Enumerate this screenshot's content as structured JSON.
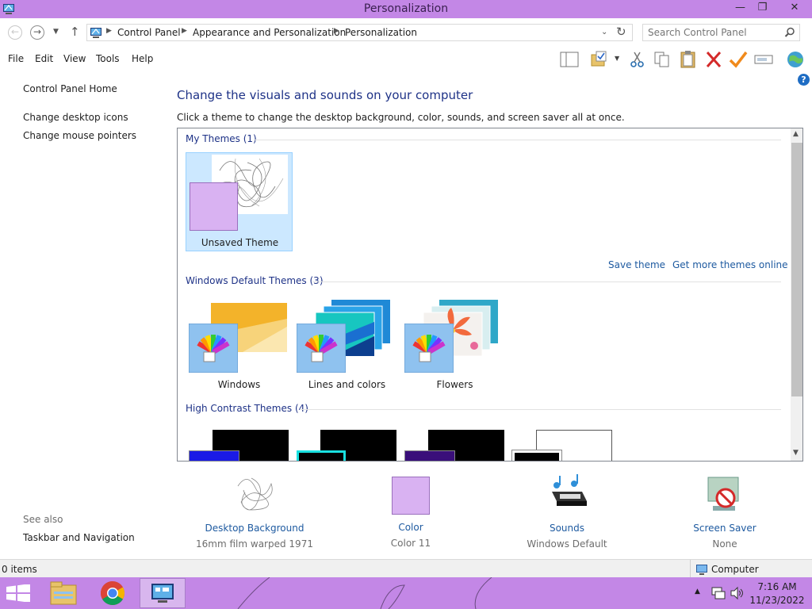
{
  "window": {
    "title": "Personalization",
    "minimize": "—",
    "restore": "❐",
    "close": "✕"
  },
  "address": {
    "crumbs": [
      "Control Panel",
      "Appearance and Personalization",
      "Personalization"
    ],
    "search_placeholder": "Search Control Panel"
  },
  "menu": {
    "file": "File",
    "edit": "Edit",
    "view": "View",
    "tools": "Tools",
    "help": "Help"
  },
  "left_pane": {
    "home": "Control Panel Home",
    "links": [
      "Change desktop icons",
      "Change mouse pointers"
    ],
    "see_also": "See also",
    "see_also_links": [
      "Taskbar and Navigation"
    ]
  },
  "main": {
    "title": "Change the visuals and sounds on your computer",
    "description": "Click a theme to change the desktop background, color, sounds, and screen saver all at once.",
    "my_themes_header": "My Themes (1)",
    "my_themes": [
      {
        "name": "Unsaved Theme",
        "selected": true
      }
    ],
    "save_theme": "Save theme",
    "get_more": "Get more themes online",
    "default_header": "Windows Default Themes (3)",
    "default_themes": [
      "Windows",
      "Lines and colors",
      "Flowers"
    ],
    "high_contrast_header": "High Contrast Themes (4)"
  },
  "settings": [
    {
      "label": "Desktop Background",
      "value": "16mm film warped 1971",
      "icon": "desktop-background-icon"
    },
    {
      "label": "Color",
      "value": "Color 11",
      "icon": "color-swatch-icon"
    },
    {
      "label": "Sounds",
      "value": "Windows Default",
      "icon": "sounds-icon"
    },
    {
      "label": "Screen Saver",
      "value": "None",
      "icon": "screen-saver-icon"
    }
  ],
  "status": {
    "items": "0 items",
    "location": "Computer"
  },
  "taskbar": {
    "time": "7:16 AM",
    "date": "11/23/2022"
  },
  "colors": {
    "accent": "#c387e6",
    "link": "#1e5aa0",
    "heading": "#1e3287",
    "selection": "#cce8ff"
  }
}
